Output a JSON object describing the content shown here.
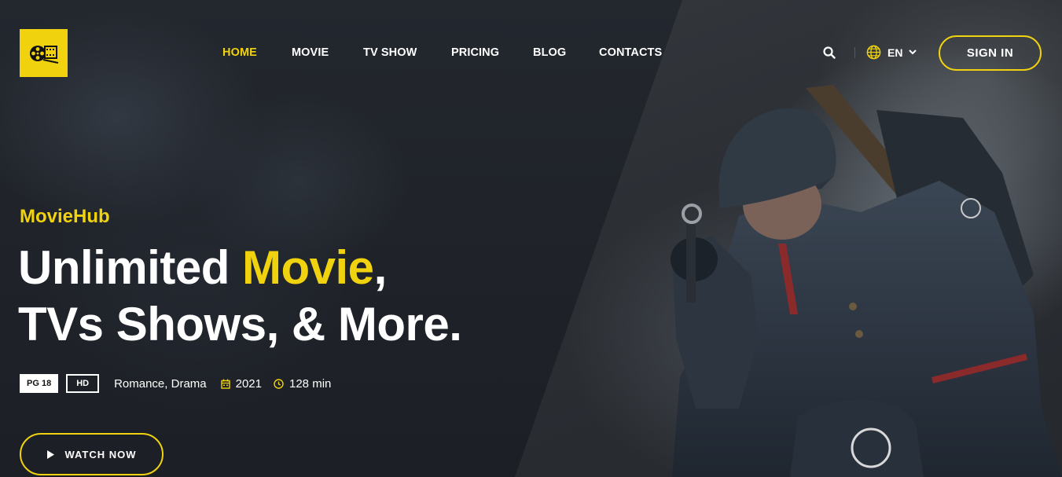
{
  "header": {
    "nav": [
      {
        "label": "HOME",
        "active": true
      },
      {
        "label": "MOVIE",
        "active": false
      },
      {
        "label": "TV SHOW",
        "active": false
      },
      {
        "label": "PRICING",
        "active": false
      },
      {
        "label": "BLOG",
        "active": false
      },
      {
        "label": "CONTACTS",
        "active": false
      }
    ],
    "language": "EN",
    "signin_label": "SIGN IN"
  },
  "hero": {
    "brand": "MovieHub",
    "title_part1": "Unlimited ",
    "title_highlight": "Movie",
    "title_part2": ",",
    "title_line2": "TVs Shows, & More.",
    "rating_badge": "PG 18",
    "quality_badge": "HD",
    "genre": "Romance, Drama",
    "year": "2021",
    "duration": "128 min",
    "watch_label": "WATCH NOW"
  },
  "colors": {
    "accent": "#f0d20f",
    "background": "#1d2026"
  },
  "icons": {
    "logo": "film-reel-icon",
    "search": "search-icon",
    "language": "globe-icon",
    "chevron": "chevron-down-icon",
    "calendar": "calendar-icon",
    "clock": "clock-icon",
    "play": "play-icon"
  }
}
